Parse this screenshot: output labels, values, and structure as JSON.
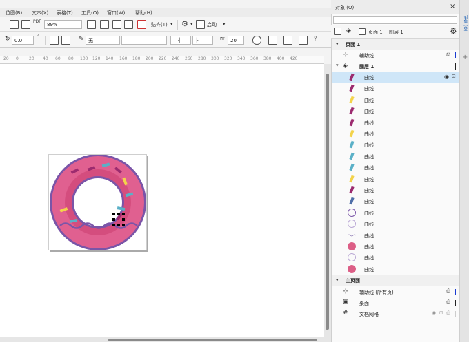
{
  "menu": [
    "位图(B)",
    "文本(X)",
    "表格(T)",
    "工具(O)",
    "窗口(W)",
    "帮助(H)"
  ],
  "toolbar": {
    "zoom": "89%",
    "snap_label": "贴齐(T)",
    "launch_label": "启动"
  },
  "propertybar": {
    "rotation": "0.0",
    "fill_label": "无",
    "size_value": "20"
  },
  "ruler": {
    "ticks": [
      "20",
      "0",
      "20",
      "40",
      "60",
      "80",
      "100",
      "120",
      "140",
      "160",
      "180",
      "200",
      "220",
      "240",
      "260",
      "280",
      "300",
      "320",
      "340",
      "360",
      "380",
      "400",
      "420"
    ]
  },
  "panel": {
    "title": "对象 (O)",
    "close": "×",
    "tab_title": "对象 (O)",
    "page_label": "页面 1",
    "layer_label": "图层 1",
    "page_section": "页面 1",
    "guides_label": "辅助线",
    "layer_section": "图层 1",
    "items": [
      {
        "label": "曲线",
        "thumb": "stroke",
        "color": "#9c2b6f",
        "selected": true
      },
      {
        "label": "曲线",
        "thumb": "stroke",
        "color": "#9c2b6f"
      },
      {
        "label": "曲线",
        "thumb": "stroke",
        "color": "#f3d34a"
      },
      {
        "label": "曲线",
        "thumb": "stroke",
        "color": "#9c2b6f"
      },
      {
        "label": "曲线",
        "thumb": "stroke",
        "color": "#9c2b6f"
      },
      {
        "label": "曲线",
        "thumb": "stroke",
        "color": "#f3d34a"
      },
      {
        "label": "曲线",
        "thumb": "stroke",
        "color": "#5ab0c7"
      },
      {
        "label": "曲线",
        "thumb": "stroke",
        "color": "#5ab0c7"
      },
      {
        "label": "曲线",
        "thumb": "stroke",
        "color": "#5ab0c7"
      },
      {
        "label": "曲线",
        "thumb": "stroke",
        "color": "#f3d34a"
      },
      {
        "label": "曲线",
        "thumb": "stroke",
        "color": "#9c2b6f"
      },
      {
        "label": "曲线",
        "thumb": "stroke",
        "color": "#4f6fa8"
      },
      {
        "label": "曲线",
        "thumb": "ring",
        "color": "#7a55a8"
      },
      {
        "label": "曲线",
        "thumb": "ring",
        "color": "#b9a7d4"
      },
      {
        "label": "曲线",
        "thumb": "wave",
        "color": "#8e7bb5"
      },
      {
        "label": "曲线",
        "thumb": "disc",
        "color": "#dc5e86"
      },
      {
        "label": "曲线",
        "thumb": "ring",
        "color": "#b9a7d4"
      },
      {
        "label": "曲线",
        "thumb": "disc",
        "color": "#dc5e86"
      }
    ],
    "master_section": "主页面",
    "master_items": [
      "辅助线 (所有页)",
      "桌面",
      "文档网格"
    ]
  },
  "colors": {
    "donut_outer": "#7a55a8",
    "donut_body": "#e06090",
    "donut_inner": "#d44d7e",
    "wave": "#7a55a8",
    "selection": "#000000",
    "accent": "#1a3bd1"
  }
}
